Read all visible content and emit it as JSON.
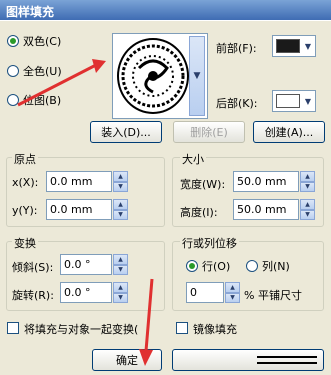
{
  "title": "图样填充",
  "fill_types": [
    {
      "label": "双色(C)",
      "selected": true
    },
    {
      "label": "全色(U)",
      "selected": false
    },
    {
      "label": "位图(B)",
      "selected": false
    }
  ],
  "front_label": "前部(F):",
  "back_label": "后部(K):",
  "front_color": "#1a1a1a",
  "back_color": "#ffffff",
  "buttons": {
    "load": "装入(D)...",
    "delete": "删除(E)",
    "create": "创建(A)...",
    "ok": "确定"
  },
  "origin": {
    "title": "原点",
    "x_label": "x(X):",
    "x_value": "0.0 mm",
    "y_label": "y(Y):",
    "y_value": "0.0 mm"
  },
  "size": {
    "title": "大小",
    "width_label": "宽度(W):",
    "width_value": "50.0 mm",
    "height_label": "高度(I):",
    "height_value": "50.0 mm"
  },
  "transform": {
    "title": "变换",
    "skew_label": "倾斜(S):",
    "skew_value": "0.0 °",
    "rotate_label": "旋转(R):",
    "rotate_value": "0.0 °"
  },
  "offset": {
    "title": "行或列位移",
    "row_label": "行(O)",
    "col_label": "列(N)",
    "row_selected": true,
    "value": "0",
    "unit_label": "% 平铺尺寸"
  },
  "checkbox_transform": "将填充与对象一起变换(",
  "checkbox_mirror": "镜像填充"
}
